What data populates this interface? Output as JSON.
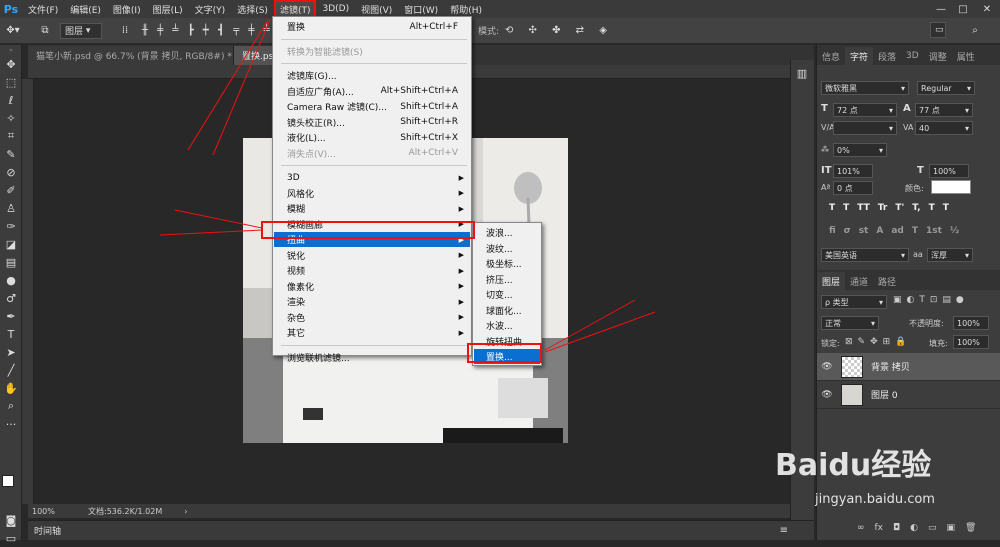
{
  "app": {
    "logo": "Ps"
  },
  "menubar": {
    "items": [
      "文件(F)",
      "编辑(E)",
      "图像(I)",
      "图层(L)",
      "文字(Y)",
      "选择(S)",
      "滤镜(T)",
      "3D(D)",
      "视图(V)",
      "窗口(W)",
      "帮助(H)"
    ],
    "active_index": 6,
    "window_controls": [
      "—",
      "□",
      "✕"
    ]
  },
  "options": {
    "layer_select": "图层",
    "right_label": "模式:"
  },
  "tabs": [
    {
      "label": "猫笔小新.psd @ 66.7% (背景 拷贝, RGB/8#) *",
      "close": "×",
      "active": false
    },
    {
      "label": "置换.ps",
      "active": true
    }
  ],
  "filter_menu": {
    "items": [
      {
        "label": "置换",
        "shortcut": "Alt+Ctrl+F",
        "disabled": false
      },
      {
        "sep": true
      },
      {
        "label": "转换为智能滤镜(S)",
        "disabled": true
      },
      {
        "sep": true
      },
      {
        "label": "滤镜库(G)...",
        "disabled": false
      },
      {
        "label": "自适应广角(A)...",
        "shortcut": "Alt+Shift+Ctrl+A",
        "disabled": false
      },
      {
        "label": "Camera Raw 滤镜(C)...",
        "shortcut": "Shift+Ctrl+A",
        "disabled": false
      },
      {
        "label": "镜头校正(R)...",
        "shortcut": "Shift+Ctrl+R",
        "disabled": false
      },
      {
        "label": "液化(L)...",
        "shortcut": "Shift+Ctrl+X",
        "disabled": false
      },
      {
        "label": "消失点(V)...",
        "shortcut": "Alt+Ctrl+V",
        "disabled": true
      },
      {
        "sep": true
      },
      {
        "label": "3D",
        "sub": true
      },
      {
        "label": "风格化",
        "sub": true
      },
      {
        "label": "模糊",
        "sub": true
      },
      {
        "label": "模糊画廊",
        "sub": true
      },
      {
        "label": "扭曲",
        "sub": true,
        "highlight": true
      },
      {
        "label": "锐化",
        "sub": true
      },
      {
        "label": "视频",
        "sub": true
      },
      {
        "label": "像素化",
        "sub": true
      },
      {
        "label": "渲染",
        "sub": true
      },
      {
        "label": "杂色",
        "sub": true
      },
      {
        "label": "其它",
        "sub": true
      },
      {
        "sep": true
      },
      {
        "label": "浏览联机滤镜..."
      }
    ]
  },
  "distort_menu": {
    "items": [
      "波浪...",
      "波纹...",
      "极坐标...",
      "挤压...",
      "切变...",
      "球面化...",
      "水波...",
      "旋转扭曲...",
      "置换..."
    ],
    "highlight_index": 8
  },
  "status": {
    "zoom": "100%",
    "doc": "文档:536.2K/1.02M",
    "arrow": "›"
  },
  "timeline": {
    "label": "时间轴"
  },
  "char_panel": {
    "tabs": [
      "信息",
      "字符",
      "段落",
      "3D",
      "调整",
      "属性"
    ],
    "active_tab": 1,
    "font_family": "微软雅黑",
    "font_style": "Regular",
    "font_size": "72 点",
    "leading": "77 点",
    "kerning": "V/A",
    "tracking": "40",
    "scale_pct": "0%",
    "vscale": "101%",
    "hscale": "100%",
    "baseline": "0 点",
    "color_label": "颜色:",
    "style_buttons": [
      "T",
      "T",
      "TT",
      "Tr",
      "T'",
      "T,",
      "T",
      "T"
    ],
    "ot_buttons": [
      "fi",
      "σ",
      "st",
      "A",
      "ad",
      "T",
      "1st",
      "½"
    ],
    "language": "美国英语",
    "aa_label": "aa",
    "aa_value": "浑厚"
  },
  "layers_panel": {
    "tabs": [
      "图层",
      "通道",
      "路径"
    ],
    "active_tab": 0,
    "filter": "ρ 类型",
    "blend_mode": "正常",
    "opacity_label": "不透明度:",
    "opacity": "100%",
    "lock_label": "锁定:",
    "fill_label": "填充:",
    "fill": "100%",
    "layers": [
      {
        "name": "背景 拷贝",
        "selected": true
      },
      {
        "name": "图层 0",
        "selected": false
      }
    ],
    "footer_icons": [
      "∞",
      "fx",
      "◘",
      "◐",
      "▭",
      "▣",
      "🗑"
    ]
  },
  "watermark": {
    "text": "Baidu经验",
    "url": "jingyan.baidu.com"
  },
  "colors": {
    "accent": "#0a6fd1",
    "red": "#e11111",
    "ps_blue": "#31a8ff"
  }
}
